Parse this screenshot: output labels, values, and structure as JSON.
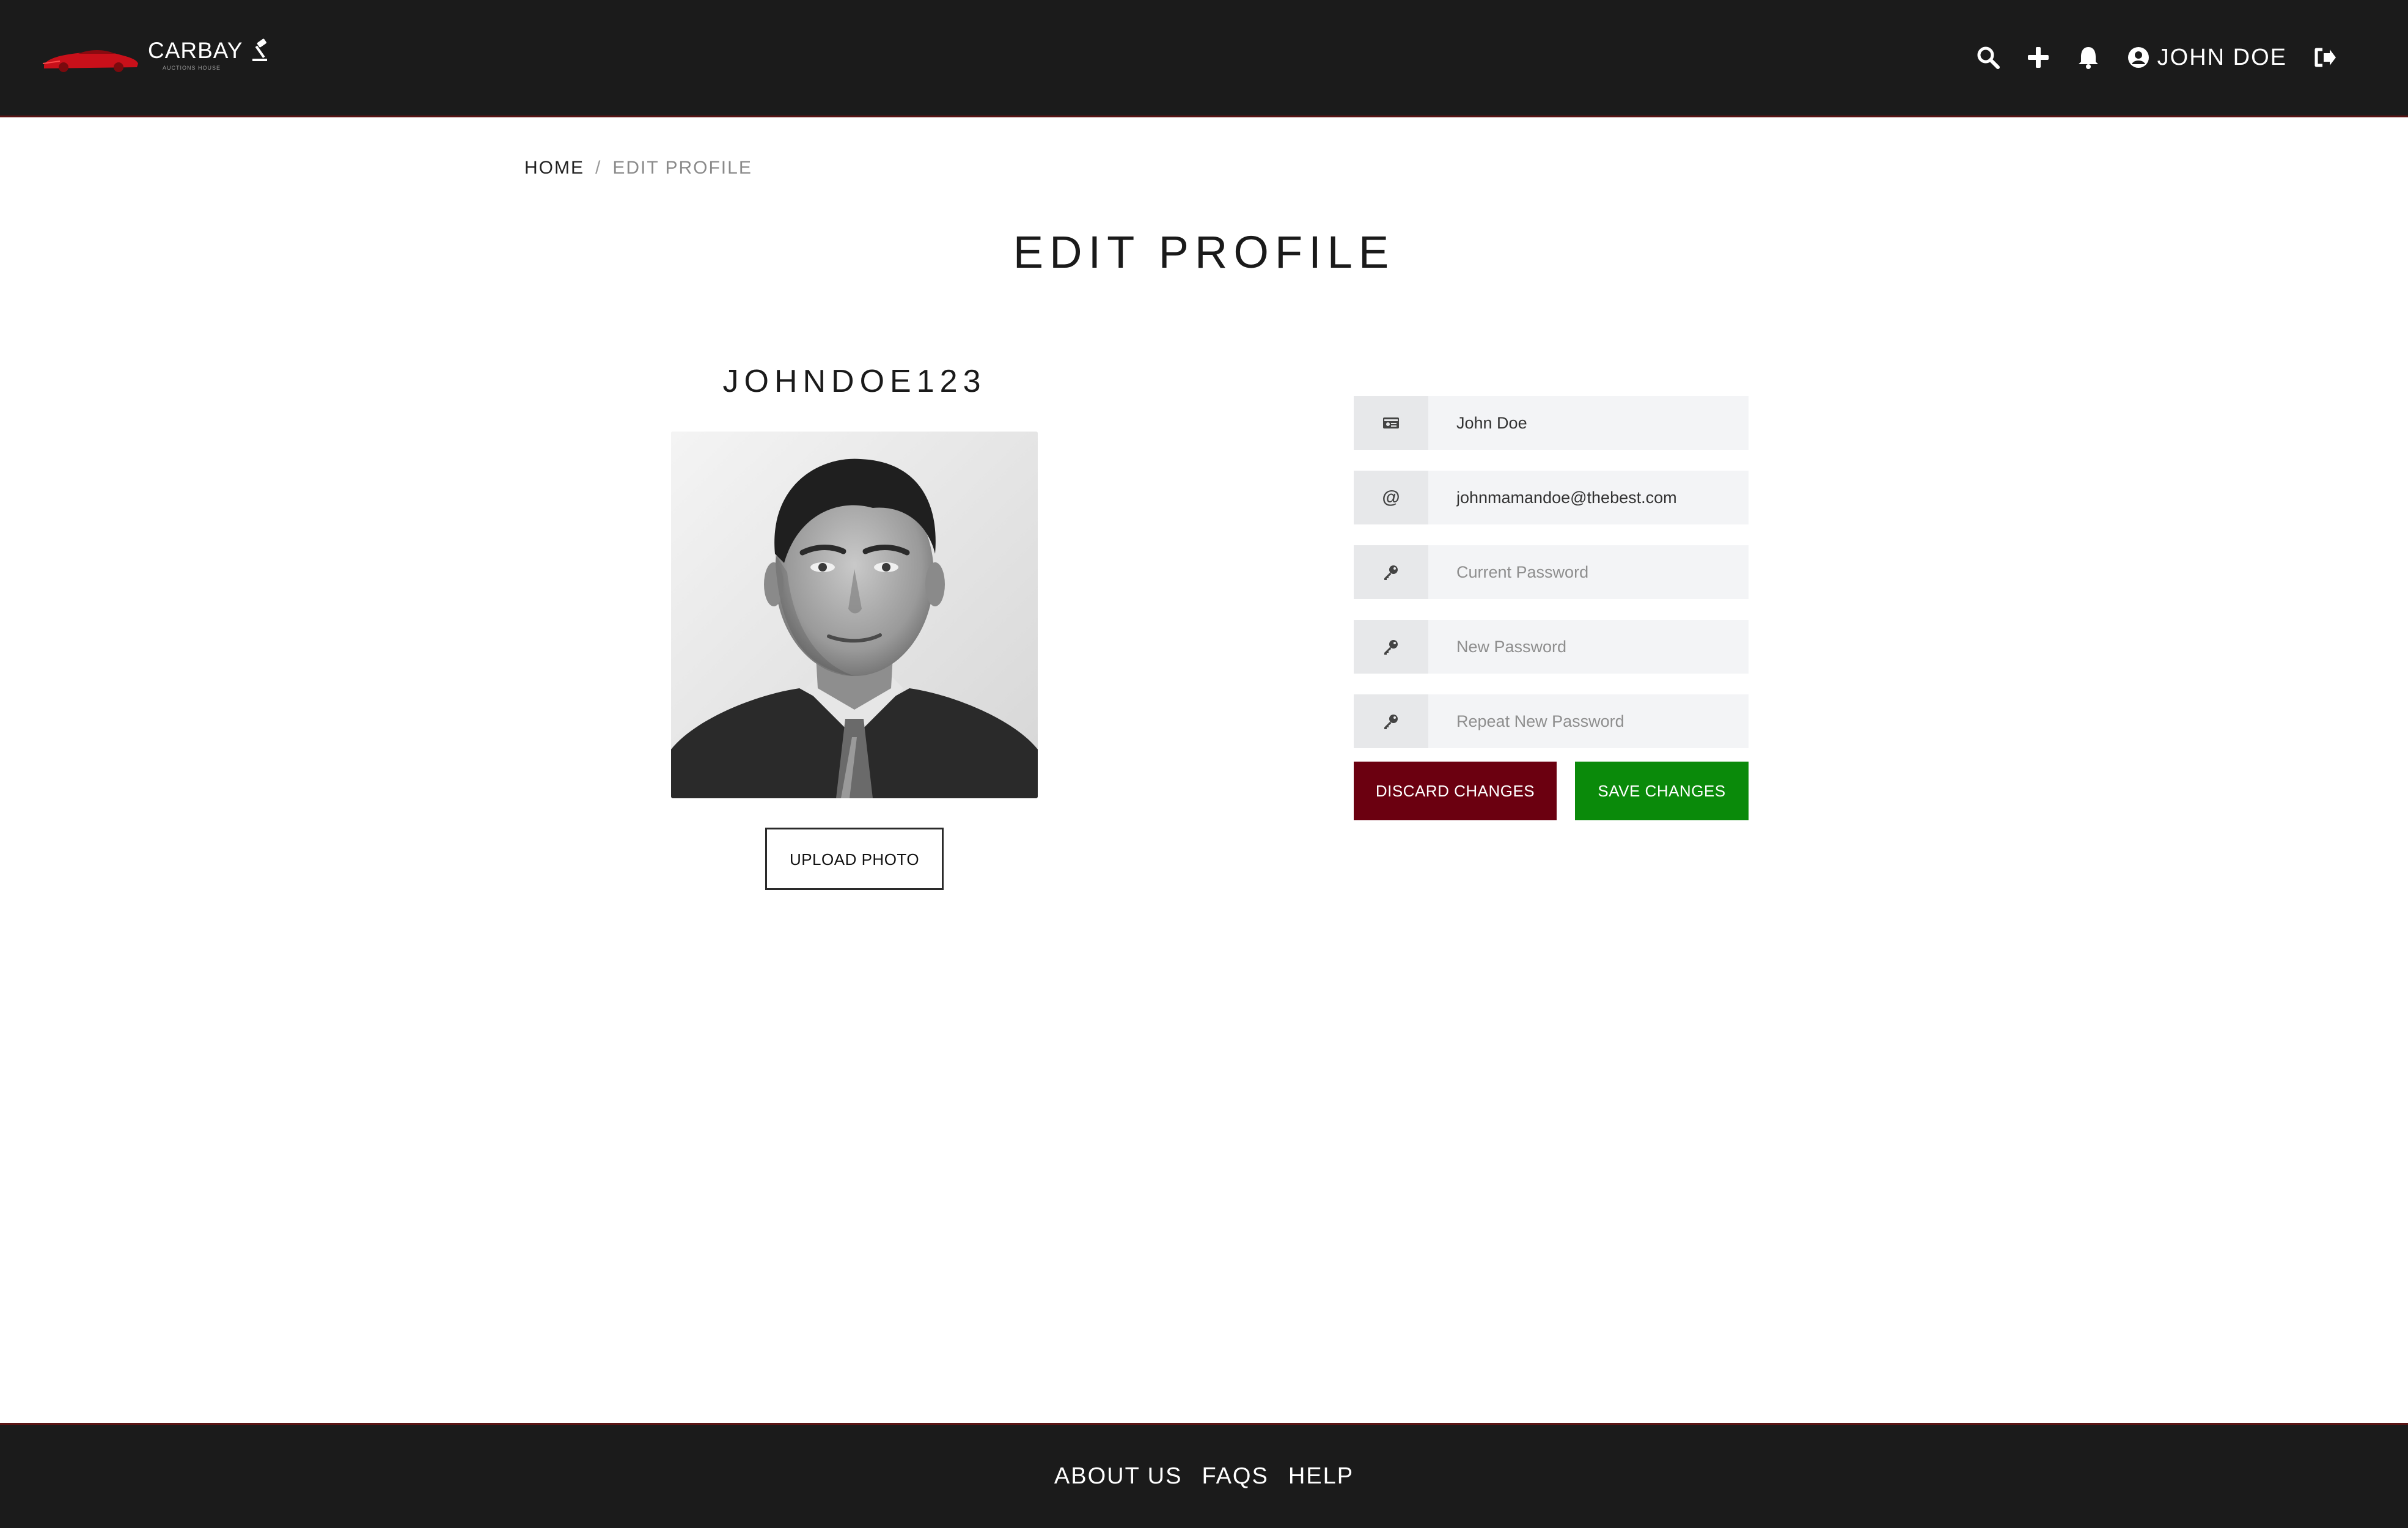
{
  "header": {
    "brand": "CARBAY",
    "brand_sub": "AUCTIONS HOUSE",
    "user_name": "JOHN DOE",
    "icons": [
      "search-icon",
      "plus-icon",
      "bell-icon",
      "user-circle-icon",
      "sign-out-icon"
    ]
  },
  "breadcrumb": {
    "home": "HOME",
    "separator": "/",
    "current": "EDIT PROFILE"
  },
  "page": {
    "title": "EDIT PROFILE"
  },
  "profile": {
    "username": "JOHNDOE123",
    "upload_label": "UPLOAD PHOTO"
  },
  "form": {
    "name_value": "John Doe",
    "email_value": "johnmamandoe@thebest.com",
    "current_password_placeholder": "Current Password",
    "new_password_placeholder": "New Password",
    "repeat_password_placeholder": "Repeat New Password",
    "discard_label": "DISCARD CHANGES",
    "save_label": "SAVE CHANGES"
  },
  "footer": {
    "links": [
      "ABOUT US",
      "FAQS",
      "HELP"
    ]
  },
  "colors": {
    "header_bg": "#1b1b1b",
    "discard": "#6b0010",
    "save": "#0a8a0a",
    "brand_accent": "#c8101a"
  }
}
